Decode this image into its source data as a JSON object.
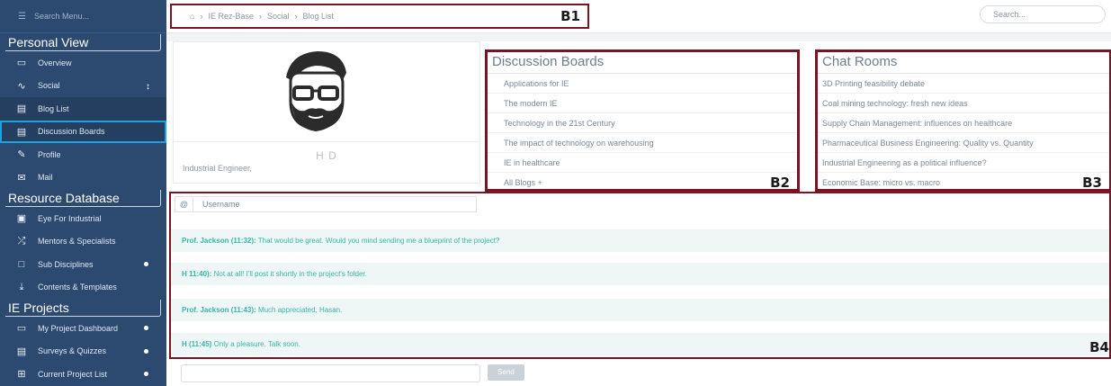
{
  "sidebar": {
    "search_placeholder": "Search Menu...",
    "sections": {
      "personal": "Personal View",
      "resource": "Resource Database",
      "projects": "IE Projects"
    },
    "personal_items": [
      "Overview",
      "Social",
      "Blog List",
      "Discussion Boards",
      "Profile",
      "Mail"
    ],
    "resource_items": [
      "Eye For Industrial",
      "Mentors & Specialists",
      "Sub Disciplines",
      "Contents & Templates"
    ],
    "project_items": [
      "My Project Dashboard",
      "Surveys & Quizzes",
      "Current Project List"
    ]
  },
  "breadcrumb": [
    "IE Rez-Base",
    "Social",
    "Blog List"
  ],
  "labels": {
    "b1": "B1",
    "b2": "B2",
    "b3": "B3",
    "b4": "B4"
  },
  "top_search_placeholder": "Search...",
  "profile": {
    "initials": "H        D",
    "role": "Industrial Engineer,"
  },
  "discussion": {
    "title": "Discussion Boards",
    "items": [
      "Applications for IE",
      "The modern IE",
      "Technology in the 21st Century",
      "The impact of technology on warehousing",
      "IE in healthcare",
      "All Blogs +"
    ]
  },
  "chatrooms": {
    "title": "Chat Rooms",
    "items": [
      "3D Printing feasibility debate",
      "Coal mining technology: fresh new ideas",
      "Supply Chain Management: influences on healthcare",
      "Pharmaceutical Business Engineering: Quality vs. Quantity",
      "Industrial Engineering as a political influence?",
      "Economic Base: micro vs. macro"
    ]
  },
  "chat": {
    "username_label": "Username",
    "messages": [
      {
        "who": "Prof. Jackson (11:32):",
        "text": "That would be great. Would you mind sending me a blueprint of the project?"
      },
      {
        "who": "H                        11:40):",
        "text": "Not at all! I'll post it shortly in the project's folder."
      },
      {
        "who": "Prof. Jackson (11:43):",
        "text": "Much appreciated, Hasan."
      },
      {
        "who": "H                        (11:45)",
        "text": "Only a pleasure. Talk soon."
      }
    ],
    "send_label": "Send"
  }
}
